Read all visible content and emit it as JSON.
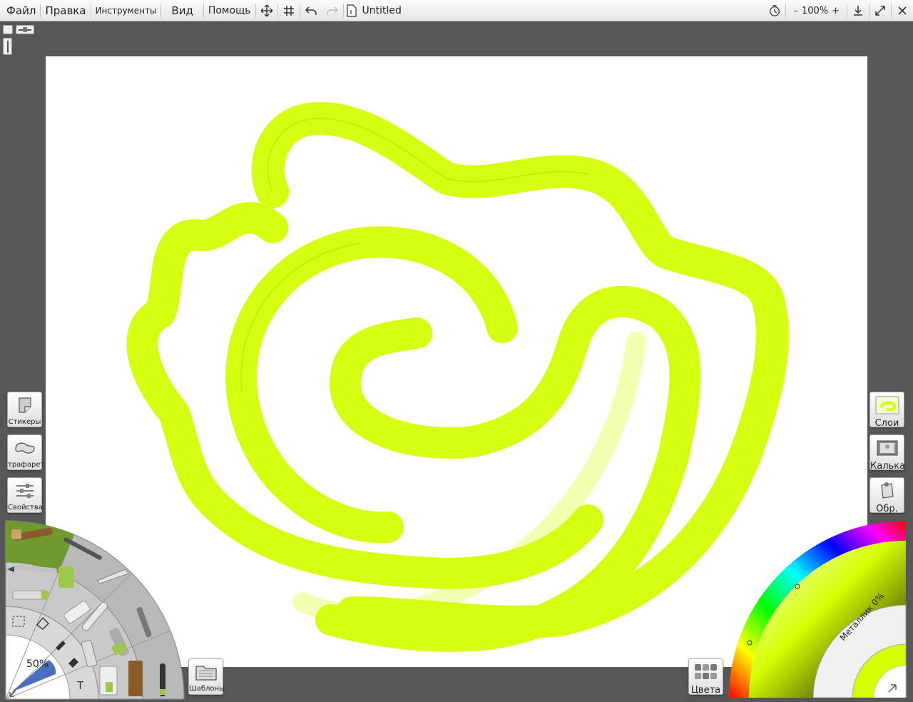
{
  "menubar": {
    "menus": [
      "Файл",
      "Правка",
      "Инструменты",
      "Вид",
      "Помощь"
    ],
    "document_title": "Untitled",
    "zoom": {
      "minus": "–",
      "value": "100%",
      "plus": "+"
    }
  },
  "left_panel": {
    "stickers": "Стикеры",
    "stencil": "трафарет",
    "properties": "Свойства",
    "templates": "Шаблоны"
  },
  "right_panel": {
    "layers": "Слои",
    "tracing": "Калька",
    "reference": "Обр.",
    "colors": "Цвета"
  },
  "tool_wheel": {
    "brush_size": "50%"
  },
  "color_picker": {
    "metallic": "Металлик 0%",
    "current_color": "#d4ff00"
  },
  "colors": {
    "paint": "#d4ff10",
    "background": "#575757",
    "canvas": "#ffffff"
  },
  "canvas": {
    "stroke_color_name": "lime"
  }
}
